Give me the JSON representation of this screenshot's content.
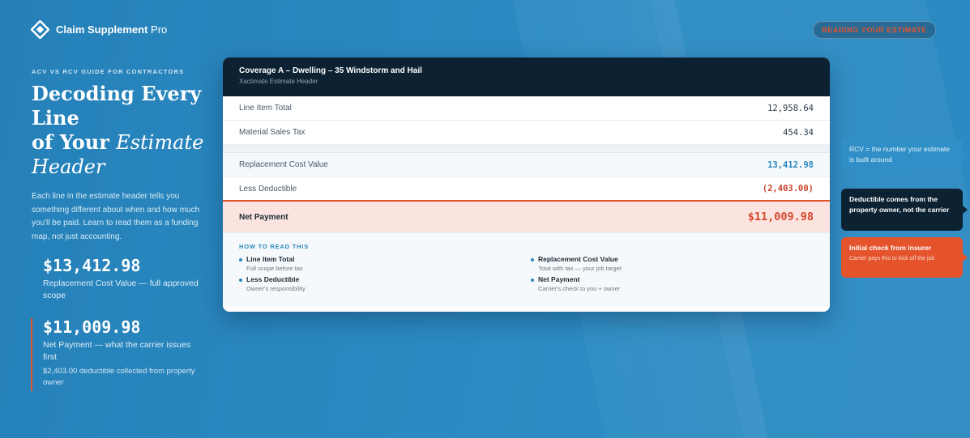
{
  "brand": {
    "name": "Claim Supplement",
    "suffix": " Pro"
  },
  "cta": {
    "label": "READING YOUR ESTIMATE"
  },
  "hero": {
    "eyebrow": "ACV VS RCV GUIDE FOR CONTRACTORS",
    "headline_line1": "Decoding Every Line",
    "headline_line2": "of Your ",
    "headline_em": "Estimate Header",
    "intro": "Each line in the estimate header tells you something different about when and how much you'll be paid. Learn to read them as a funding map, not just accounting."
  },
  "stats": [
    {
      "value": "$13,412.98",
      "label": "Replacement Cost Value — full approved scope"
    },
    {
      "value": "$11,009.98",
      "label": "Net Payment — what the carrier issues first",
      "sub": "$2,403.00 deductible collected from property owner"
    }
  ],
  "card": {
    "title": "Coverage A – Dwelling – 35 Windstorm and Hail",
    "subtitle": "Xactimate Estimate Header",
    "rows": [
      {
        "label": "Line Item Total",
        "value": "12,958.64"
      },
      {
        "label": "Material Sales Tax",
        "value": "454.34"
      },
      {
        "label": "Replacement Cost Value",
        "value": "13,412.98"
      },
      {
        "label": "Less Deductible",
        "value": "(2,403.00)"
      },
      {
        "label": "Net Payment",
        "value": "$11,009.98"
      }
    ],
    "howto": {
      "title": "HOW TO READ THIS",
      "items": [
        {
          "name": "Line Item Total",
          "desc": "Full scope before tax"
        },
        {
          "name": "Replacement Cost Value",
          "desc": "Total with tax — your job target"
        },
        {
          "name": "Less Deductible",
          "desc": "Owner's responsibility"
        },
        {
          "name": "Net Payment",
          "desc": "Carrier's check to you + owner"
        }
      ]
    }
  },
  "callouts": [
    {
      "text": "RCV = the number your estimate is built around"
    },
    {
      "text": "Deductible comes from the property owner, not the carrier"
    },
    {
      "title": "Initial check from insurer",
      "sub": "Carrier pays this to kick off the job"
    }
  ],
  "colors": {
    "accent": "#e4532b",
    "brand_blue": "#2a87bd",
    "navy": "#0c2233"
  }
}
